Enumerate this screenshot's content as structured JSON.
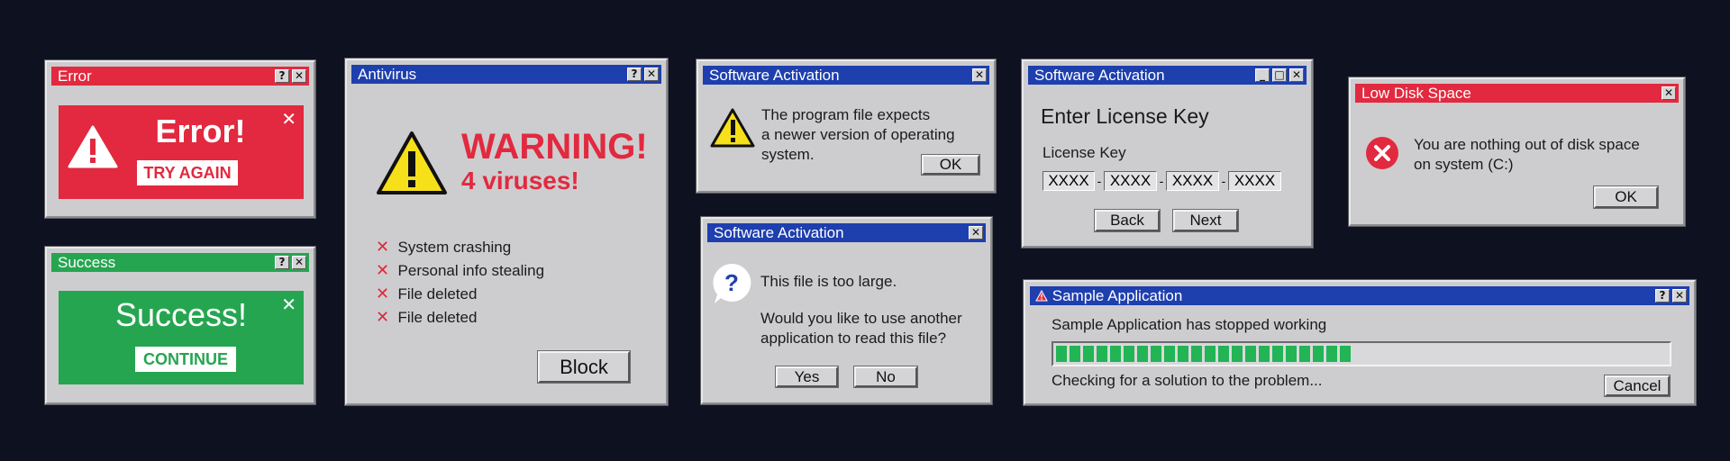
{
  "colors": {
    "background": "#0e1120",
    "titlebar_blue": "#1e3fae",
    "titlebar_red": "#e2293f",
    "titlebar_green": "#26a550",
    "alert_red": "#e2293f",
    "progress_green": "#22b455",
    "warning_yellow": "#f6e01a"
  },
  "icons": {
    "help": "?",
    "close": "✕",
    "minimize": "_",
    "maximize": "□",
    "red_x": "✕",
    "warning": "!",
    "question": "?"
  },
  "error_window": {
    "title": "Error",
    "heading": "Error!",
    "button": "TRY AGAIN"
  },
  "success_window": {
    "title": "Success",
    "heading": "Success!",
    "button": "CONTINUE"
  },
  "antivirus_window": {
    "title": "Antivirus",
    "warning": "WARNING!",
    "subheading": "4 viruses!",
    "items": [
      "System crashing",
      "Personal info stealing",
      "File deleted",
      "File deleted"
    ],
    "button": "Block"
  },
  "activation1": {
    "title": "Software Activation",
    "message": [
      "The program file expects",
      "a newer version of operating",
      "system."
    ],
    "button": "OK"
  },
  "activation2": {
    "title": "Software Activation",
    "line1": "This file is too large.",
    "line2": [
      "Would you like to use another",
      "application to read this file?"
    ],
    "yes": "Yes",
    "no": "No"
  },
  "license_window": {
    "title": "Software Activation",
    "heading": "Enter License Key",
    "label": "License Key",
    "fields": [
      "XXXX",
      "XXXX",
      "XXXX",
      "XXXX"
    ],
    "separator": "-",
    "back": "Back",
    "next": "Next"
  },
  "disk_window": {
    "title": "Low Disk Space",
    "message": [
      "You are nothing out of disk space",
      "on system (C:)"
    ],
    "button": "OK"
  },
  "sample_app": {
    "title": "Sample Application",
    "message": "Sample Application has stopped working",
    "status": "Checking for a solution to the problem...",
    "button": "Cancel",
    "progress": 0.49,
    "segments": 22
  }
}
